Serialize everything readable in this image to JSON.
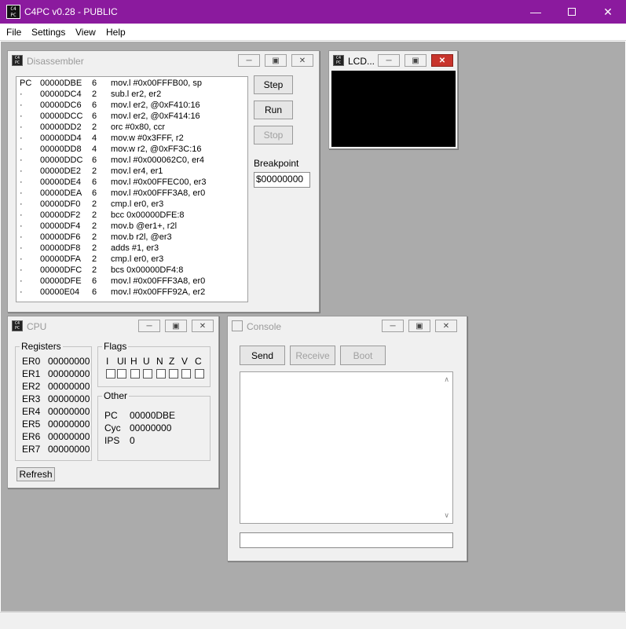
{
  "window": {
    "title": "C4PC v0.28 - PUBLIC",
    "icon_text": "C4\nPC"
  },
  "menu": [
    "File",
    "Settings",
    "View",
    "Help"
  ],
  "disassembler": {
    "title": "Disassembler",
    "rows": [
      [
        "PC",
        "00000DBE",
        "6",
        "mov.l #0x00FFFB00, sp"
      ],
      [
        "·",
        "00000DC4",
        "2",
        "sub.l er2, er2"
      ],
      [
        "·",
        "00000DC6",
        "6",
        "mov.l er2, @0xF410:16"
      ],
      [
        "·",
        "00000DCC",
        "6",
        "mov.l er2, @0xF414:16"
      ],
      [
        "·",
        "00000DD2",
        "2",
        "orc #0x80, ccr"
      ],
      [
        "·",
        "00000DD4",
        "4",
        "mov.w #0x3FFF, r2"
      ],
      [
        "·",
        "00000DD8",
        "4",
        "mov.w r2, @0xFF3C:16"
      ],
      [
        "·",
        "00000DDC",
        "6",
        "mov.l #0x000062C0, er4"
      ],
      [
        "·",
        "00000DE2",
        "2",
        "mov.l er4, er1"
      ],
      [
        "·",
        "00000DE4",
        "6",
        "mov.l #0x00FFEC00, er3"
      ],
      [
        "·",
        "00000DEA",
        "6",
        "mov.l #0x00FFF3A8, er0"
      ],
      [
        "·",
        "00000DF0",
        "2",
        "cmp.l er0, er3"
      ],
      [
        "·",
        "00000DF2",
        "2",
        "bcc 0x00000DFE:8"
      ],
      [
        "·",
        "00000DF4",
        "2",
        "mov.b @er1+, r2l"
      ],
      [
        "·",
        "00000DF6",
        "2",
        "mov.b r2l, @er3"
      ],
      [
        "·",
        "00000DF8",
        "2",
        "adds #1, er3"
      ],
      [
        "·",
        "00000DFA",
        "2",
        "cmp.l er0, er3"
      ],
      [
        "·",
        "00000DFC",
        "2",
        "bcs 0x00000DF4:8"
      ],
      [
        "·",
        "00000DFE",
        "6",
        "mov.l #0x00FFF3A8, er0"
      ],
      [
        "·",
        "00000E04",
        "6",
        "mov.l #0x00FFF92A, er2"
      ]
    ],
    "step": "Step",
    "run": "Run",
    "stop": "Stop",
    "breakpoint_label": "Breakpoint",
    "breakpoint_value": "$00000000"
  },
  "lcd": {
    "title": "LCD..."
  },
  "cpu": {
    "title": "CPU",
    "registers_label": "Registers",
    "registers": [
      [
        "ER0",
        "00000000"
      ],
      [
        "ER1",
        "00000000"
      ],
      [
        "ER2",
        "00000000"
      ],
      [
        "ER3",
        "00000000"
      ],
      [
        "ER4",
        "00000000"
      ],
      [
        "ER5",
        "00000000"
      ],
      [
        "ER6",
        "00000000"
      ],
      [
        "ER7",
        "00000000"
      ]
    ],
    "flags_label": "Flags",
    "flags": [
      "I",
      "UI",
      "H",
      "U",
      "N",
      "Z",
      "V",
      "C"
    ],
    "other_label": "Other",
    "other": [
      [
        "PC",
        "00000DBE"
      ],
      [
        "Cyc",
        "00000000"
      ],
      [
        "IPS",
        "0"
      ]
    ],
    "refresh": "Refresh"
  },
  "console": {
    "title": "Console",
    "send": "Send",
    "receive": "Receive",
    "boot": "Boot",
    "input_value": ""
  },
  "colors": {
    "titlebar": "#8b1a9e",
    "mdi_background": "#ababab",
    "close_red": "#c8342c"
  }
}
